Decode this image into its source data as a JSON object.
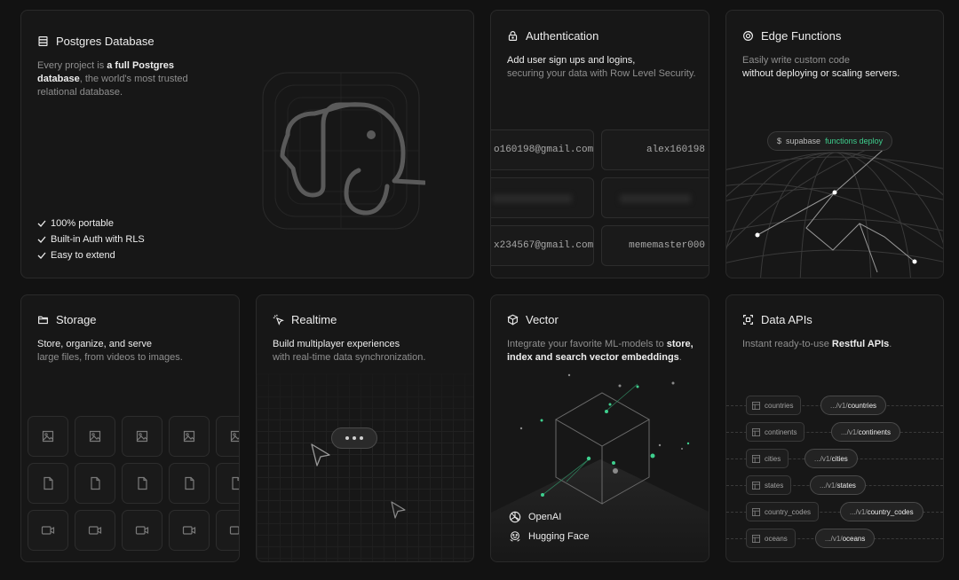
{
  "postgres": {
    "title": "Postgres Database",
    "desc_1": "Every project is ",
    "desc_bold": "a full Postgres database",
    "desc_2": ", the world's most trusted relational database.",
    "features": [
      "100% portable",
      "Built-in Auth with RLS",
      "Easy to extend"
    ],
    "icon": "database-icon"
  },
  "auth": {
    "title": "Authentication",
    "desc_line1": "Add user sign ups and logins,",
    "desc_line2": "securing your data with Row Level Security.",
    "emails": [
      "o160198@gmail.com",
      "alex160198",
      "x234567@gmail.com",
      "mememaster000"
    ],
    "icon": "lock-icon"
  },
  "edge": {
    "title": "Edge Functions",
    "desc_line1": "Easily write custom code",
    "desc_line2": "without deploying or scaling servers.",
    "cmd_prefix": "$",
    "cmd_base": "supabase",
    "cmd_args": "functions deploy",
    "icon": "edge-functions-icon"
  },
  "storage": {
    "title": "Storage",
    "desc_line1": "Store, organize, and serve",
    "desc_line2": "large files, from videos to images.",
    "icon": "folder-icon"
  },
  "realtime": {
    "title": "Realtime",
    "desc_line1": "Build multiplayer experiences",
    "desc_line2": "with real-time data synchronization.",
    "icon": "cursor-click-icon"
  },
  "vector": {
    "title": "Vector",
    "desc_1": "Integrate your favorite ML-models to ",
    "desc_bold1": "store,",
    "desc_bold2": "index and search vector embeddings",
    "desc_end": ".",
    "vendors": [
      "OpenAI",
      "Hugging Face"
    ],
    "icon": "cube-icon"
  },
  "apis": {
    "title": "Data APIs",
    "desc_1": "Instant ready-to-use ",
    "desc_bold": "Restful APIs",
    "desc_end": ".",
    "rows": [
      {
        "table": "countries",
        "prefix": ".../v1/",
        "path": "countries"
      },
      {
        "table": "continents",
        "prefix": ".../v1/",
        "path": "continents"
      },
      {
        "table": "cities",
        "prefix": ".../v1/",
        "path": "cities"
      },
      {
        "table": "states",
        "prefix": ".../v1/",
        "path": "states"
      },
      {
        "table": "country_codes",
        "prefix": ".../v1/",
        "path": "country_codes"
      },
      {
        "table": "oceans",
        "prefix": ".../v1/",
        "path": "oceans"
      }
    ],
    "icon": "data-api-icon"
  },
  "colors": {
    "background": "#121212",
    "card": "#171717",
    "border": "#2a2a2a",
    "accent": "#3ecf8e"
  }
}
